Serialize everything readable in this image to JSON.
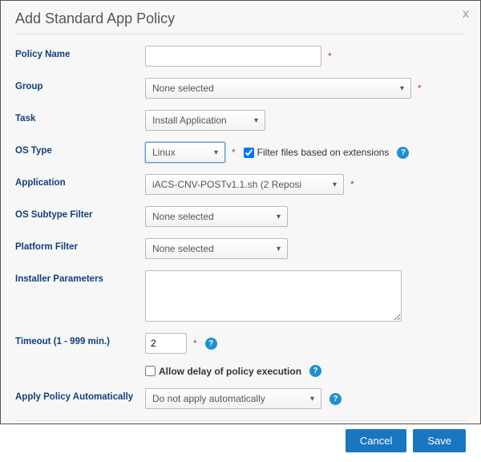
{
  "dialog": {
    "title": "Add Standard App Policy",
    "close": "x"
  },
  "labels": {
    "policy_name": "Policy Name",
    "group": "Group",
    "task": "Task",
    "os_type": "OS Type",
    "application": "Application",
    "os_subtype_filter": "OS Subtype Filter",
    "platform_filter": "Platform Filter",
    "installer_parameters": "Installer Parameters",
    "timeout": "Timeout (1 - 999 min.)",
    "apply_auto": "Apply Policy Automatically"
  },
  "values": {
    "policy_name": "",
    "group": "None selected",
    "task": "Install Application",
    "os_type": "Linux",
    "application": "iACS-CNV-POSTv1.1.sh (2 Reposi",
    "os_subtype_filter": "None selected",
    "platform_filter": "None selected",
    "installer_parameters": "",
    "timeout": "2",
    "apply_auto": "Do not apply automatically"
  },
  "checkboxes": {
    "filter_ext": {
      "checked": true,
      "label": "Filter files based on extensions"
    },
    "allow_delay": {
      "checked": false,
      "label": "Allow delay of policy execution"
    }
  },
  "buttons": {
    "cancel": "Cancel",
    "save": "Save"
  },
  "misc": {
    "required_mark": "*",
    "help_glyph": "?"
  }
}
